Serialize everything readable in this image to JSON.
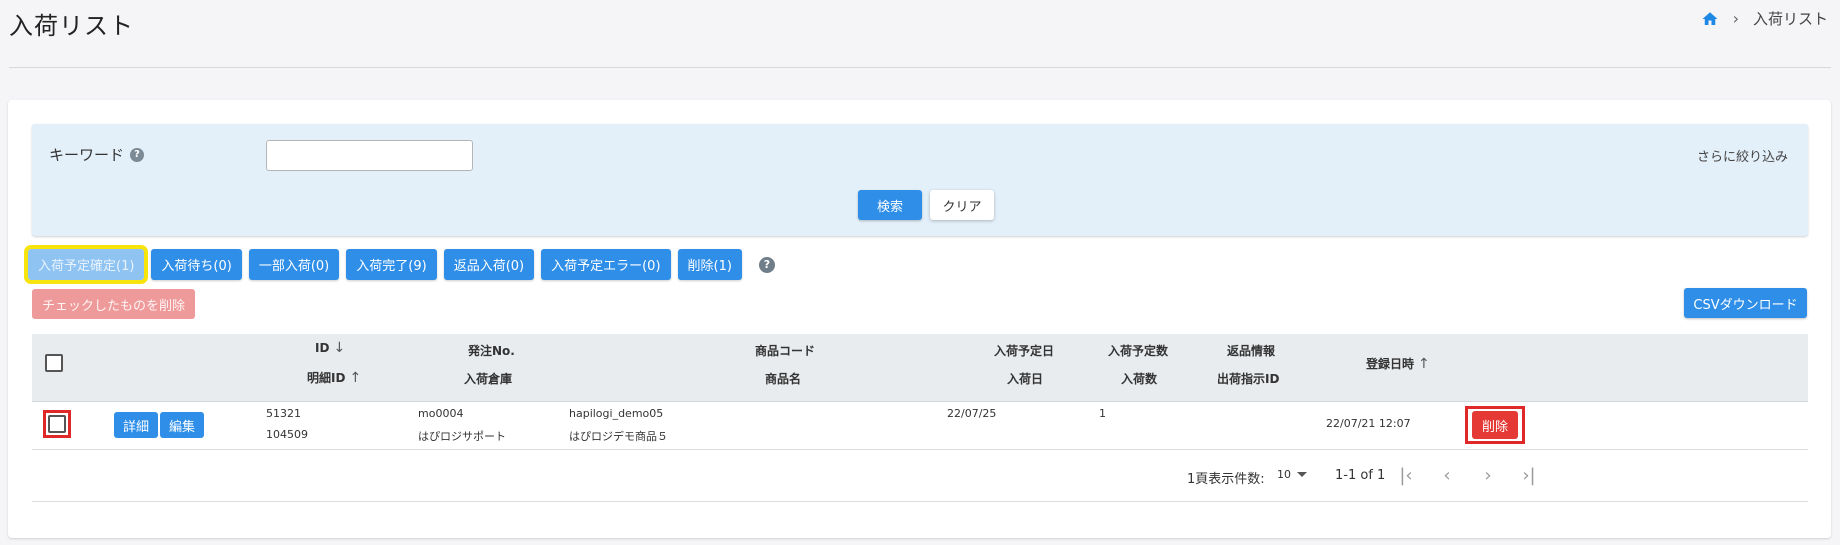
{
  "page": {
    "title": "入荷リスト",
    "breadcrumb": {
      "current": "入荷リスト"
    }
  },
  "search": {
    "keyword_label": "キーワード",
    "keyword_value": "",
    "refine_link": "さらに絞り込み",
    "search_button": "検索",
    "clear_button": "クリア"
  },
  "status_filters": [
    {
      "label": "入荷予定確定(1)",
      "active": true
    },
    {
      "label": "入荷待ち(0)"
    },
    {
      "label": "一部入荷(0)"
    },
    {
      "label": "入荷完了(9)"
    },
    {
      "label": "返品入荷(0)"
    },
    {
      "label": "入荷予定エラー(0)"
    },
    {
      "label": "削除(1)"
    }
  ],
  "actions": {
    "delete_checked": "チェックしたものを削除",
    "csv_download": "CSVダウンロード"
  },
  "table": {
    "headers": {
      "id": "ID",
      "detail_id": "明細ID",
      "order_no": "発注No.",
      "warehouse": "入荷倉庫",
      "product_code": "商品コード",
      "product_name": "商品名",
      "scheduled_date": "入荷予定日",
      "arrival_date": "入荷日",
      "scheduled_qty": "入荷予定数",
      "arrival_qty": "入荷数",
      "return_info": "返品情報",
      "ship_instruction_id": "出荷指示ID",
      "registered_at": "登録日時"
    },
    "rows": [
      {
        "detail_button": "詳細",
        "edit_button": "編集",
        "id": "51321",
        "detail_id": "104509",
        "order_no": "mo0004",
        "warehouse": "はぴロジサポート",
        "product_code": "hapilogi_demo05",
        "product_name": "はぴロジデモ商品５",
        "scheduled_date": "22/07/25",
        "scheduled_qty": "1",
        "registered_at": "22/07/21 12:07",
        "delete_button": "削除"
      }
    ]
  },
  "pagination": {
    "per_page_label": "1頁表示件数:",
    "per_page_value": "10",
    "range": "1-1 of 1"
  },
  "colors": {
    "primary": "#2f8fe8",
    "danger": "#e53935",
    "highlight_yellow": "#f7e40d",
    "highlight_red": "#e02828"
  }
}
